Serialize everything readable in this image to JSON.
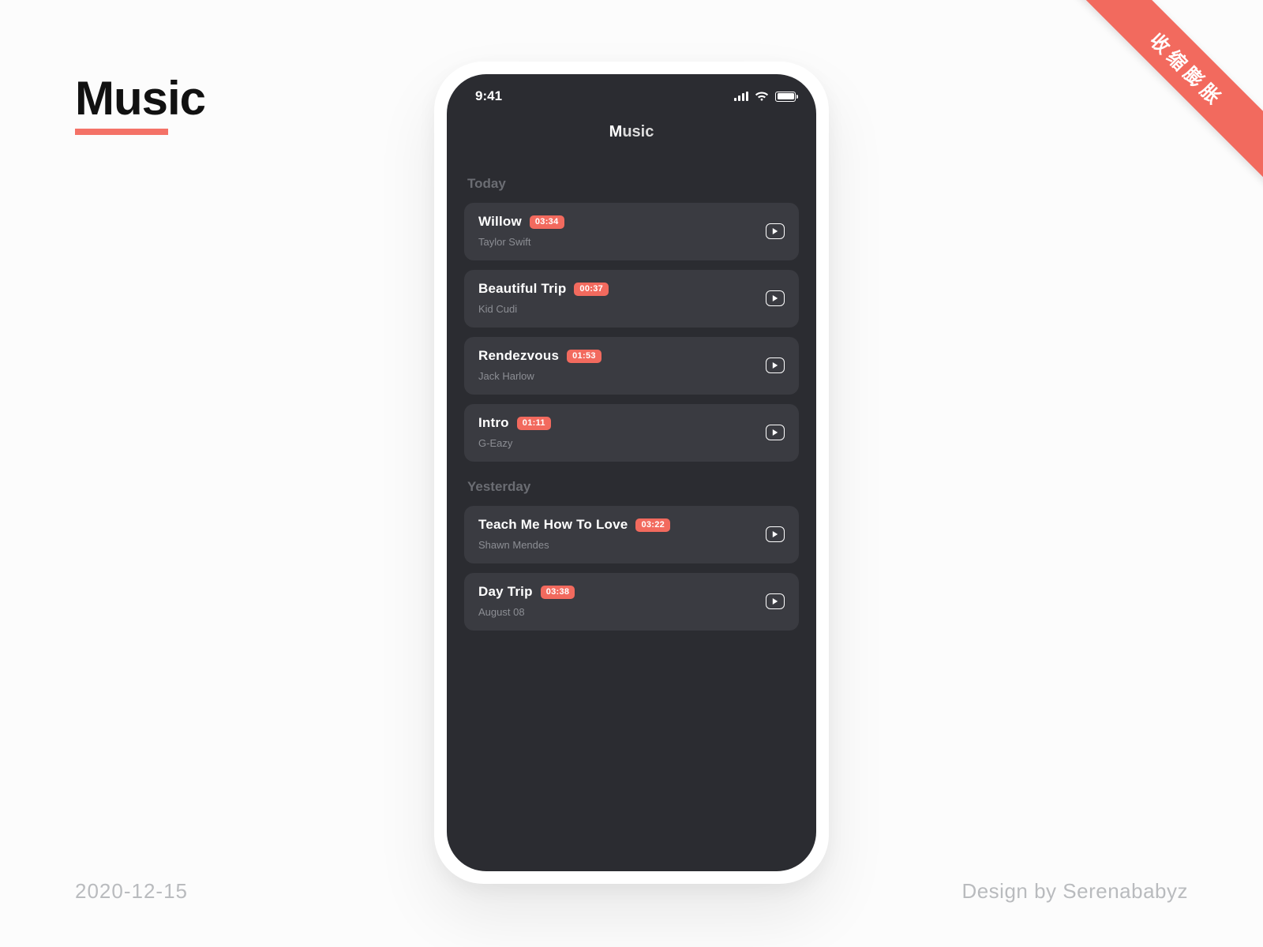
{
  "brand": {
    "title": "Music"
  },
  "ribbon": {
    "label": "收缩膨胀"
  },
  "footer": {
    "date": "2020-12-15",
    "credit": "Design by Serenababyz"
  },
  "status_bar": {
    "time": "9:41"
  },
  "app": {
    "title_lead": "M",
    "title_rest": "usic"
  },
  "sections": [
    {
      "label": "Today",
      "tracks": [
        {
          "title": "Willow",
          "duration": "03:34",
          "artist": "Taylor Swift"
        },
        {
          "title": "Beautiful Trip",
          "duration": "00:37",
          "artist": "Kid Cudi"
        },
        {
          "title": "Rendezvous",
          "duration": "01:53",
          "artist": "Jack Harlow"
        },
        {
          "title": "Intro",
          "duration": "01:11",
          "artist": "G-Eazy"
        }
      ]
    },
    {
      "label": "Yesterday",
      "tracks": [
        {
          "title": "Teach Me How To Love",
          "duration": "03:22",
          "artist": "Shawn Mendes"
        },
        {
          "title": "Day Trip",
          "duration": "03:38",
          "artist": "August 08"
        }
      ]
    }
  ]
}
